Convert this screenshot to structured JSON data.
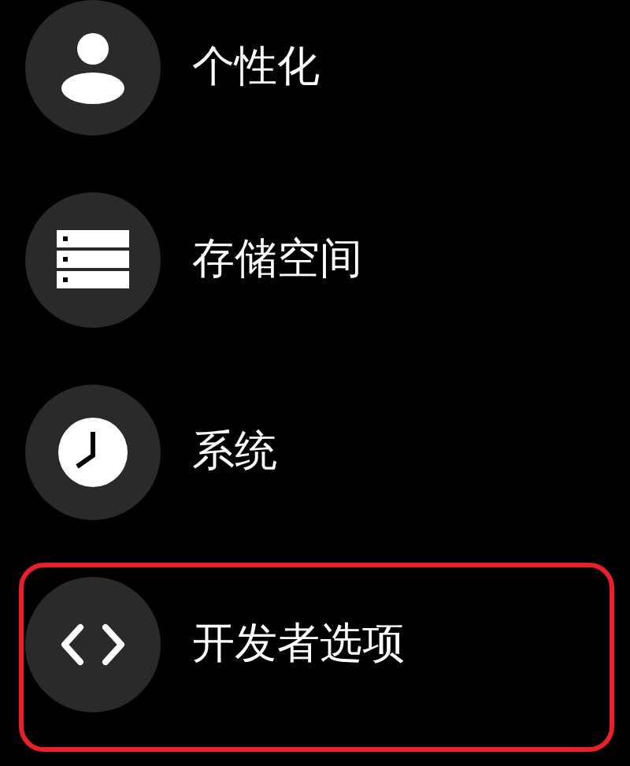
{
  "settings": {
    "items": [
      {
        "label": "个性化",
        "highlighted": false
      },
      {
        "label": "存储空间",
        "highlighted": false
      },
      {
        "label": "系统",
        "highlighted": false
      },
      {
        "label": "开发者选项",
        "highlighted": true
      }
    ]
  }
}
